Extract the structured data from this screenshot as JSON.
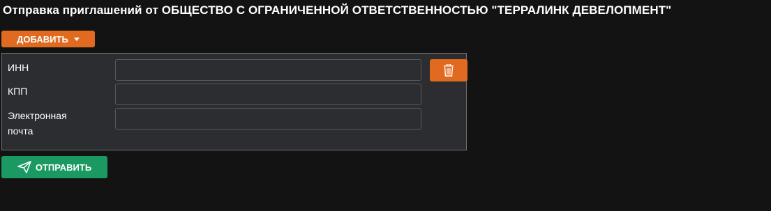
{
  "page": {
    "title": "Отправка приглашений от ОБЩЕСТВО С ОГРАНИЧЕННОЙ ОТВЕТСТВЕННОСТЬЮ \"ТЕРРАЛИНК ДЕВЕЛОПМЕНТ\""
  },
  "toolbar": {
    "add_label": "ДОБАВИТЬ",
    "add_icon": "chevron-down-icon"
  },
  "form": {
    "fields": [
      {
        "label": "ИНН",
        "value": ""
      },
      {
        "label": "КПП",
        "value": ""
      },
      {
        "label_line1": "Электронная",
        "label_line2": "почта",
        "value": ""
      }
    ],
    "delete_icon": "trash-icon"
  },
  "actions": {
    "send_label": "ОТПРАВИТЬ",
    "send_icon": "paper-plane-icon"
  },
  "colors": {
    "background": "#131313",
    "accent_orange": "#e06a1f",
    "accent_green": "#1a9a62",
    "panel": "#2b2d31"
  }
}
